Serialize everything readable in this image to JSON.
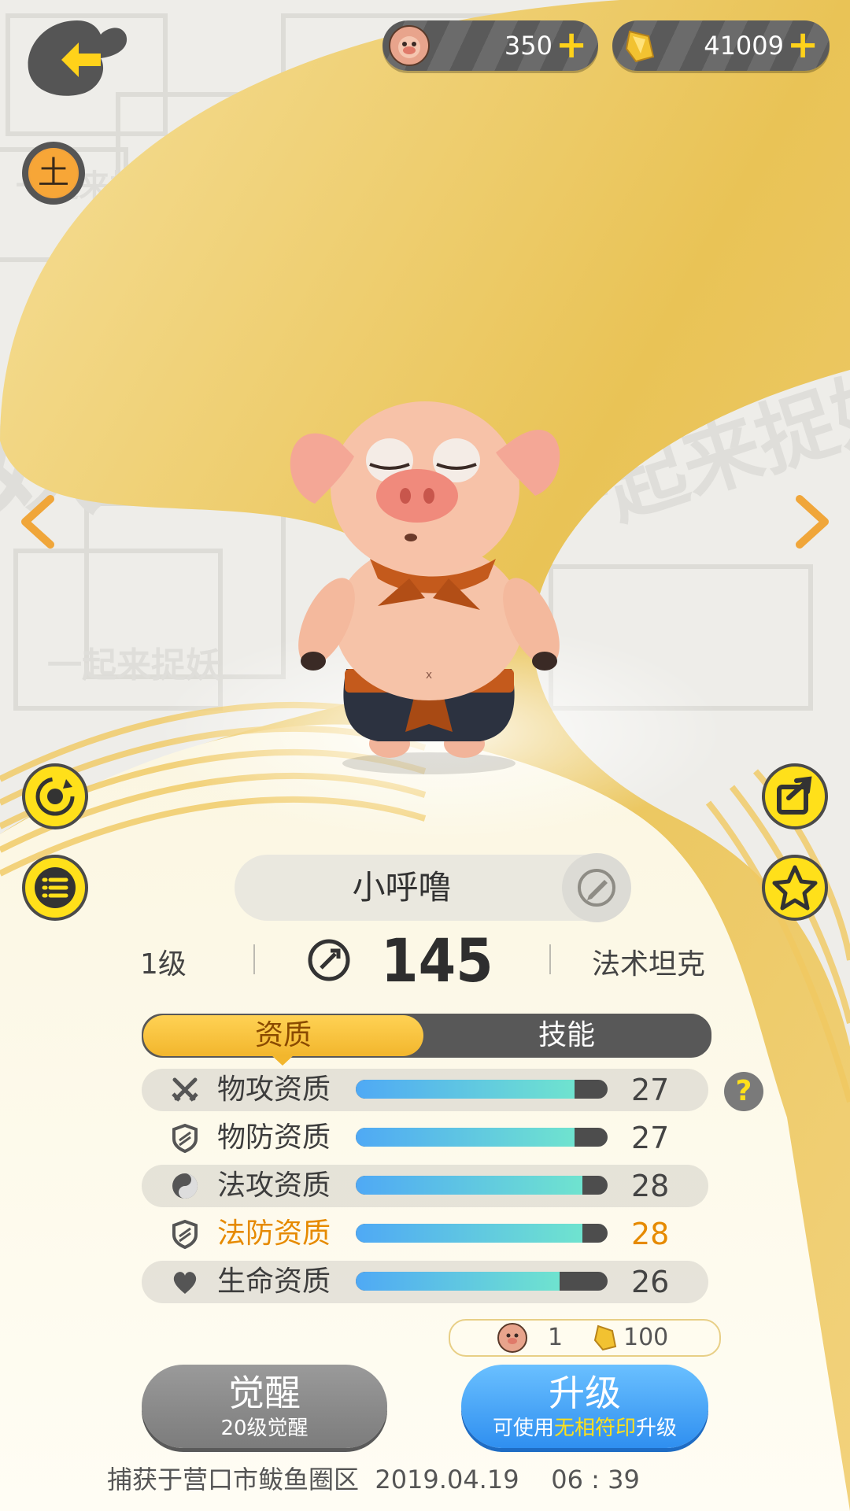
{
  "currency": {
    "pig_coin": {
      "icon": "pig-coin-icon",
      "value": "350"
    },
    "crystal": {
      "icon": "crystal-icon",
      "value": "41009"
    },
    "plus_label": "+"
  },
  "side_left": {
    "back": "back-arrow-icon",
    "element": "earth-element-icon",
    "element_char": "土",
    "rotate": "rotate-icon",
    "list": "list-icon"
  },
  "side_right": {
    "share": "share-icon",
    "favorite": "star-icon"
  },
  "nav": {
    "prev": "chevron-left-icon",
    "next": "chevron-right-icon"
  },
  "pet": {
    "name": "小呼噜",
    "level": "1级",
    "power": "145",
    "role": "法术坦克"
  },
  "tabs": [
    {
      "label": "资质",
      "active": true
    },
    {
      "label": "技能",
      "active": false
    }
  ],
  "attributes": [
    {
      "icon": "crossed-swords-icon",
      "label": "物攻资质",
      "value": "27",
      "fill": 0.87,
      "highlight": false
    },
    {
      "icon": "shield-icon",
      "label": "物防资质",
      "value": "27",
      "fill": 0.87,
      "highlight": false
    },
    {
      "icon": "yin-yang-icon",
      "label": "法攻资质",
      "value": "28",
      "fill": 0.9,
      "highlight": false
    },
    {
      "icon": "shield-icon",
      "label": "法防资质",
      "value": "28",
      "fill": 0.9,
      "highlight": true
    },
    {
      "icon": "heart-icon",
      "label": "生命资质",
      "value": "26",
      "fill": 0.81,
      "highlight": false
    }
  ],
  "help": {
    "label": "?"
  },
  "cost": {
    "pig_coin": "1",
    "crystal": "100"
  },
  "awaken_button": {
    "label": "觉醒",
    "sub": "20级觉醒"
  },
  "upgrade_button": {
    "label": "升级",
    "sub_prefix": "可使用",
    "sub_highlight": "无相符印",
    "sub_suffix": "升级"
  },
  "footer": {
    "text": "捕获于营口市鲅鱼圈区  2019.04.19    06 : 39"
  },
  "colors": {
    "gold": "#f2c24a",
    "yellow_button": "#ffe01a",
    "blue_button": "#3d9cf5",
    "highlight_orange": "#e68a00"
  }
}
